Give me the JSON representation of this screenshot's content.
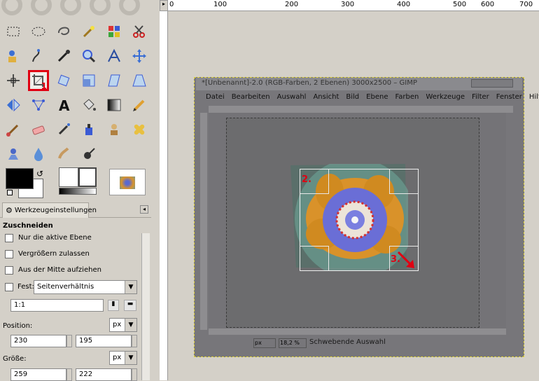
{
  "toolbox": {
    "tools": [
      "rect-select",
      "ellipse-select",
      "free-select",
      "fuzzy-select",
      "select-by-color",
      "scissors",
      "foreground-select",
      "paths",
      "color-picker",
      "zoom",
      "measure",
      "move",
      "align",
      "crop",
      "rotate",
      "scale",
      "shear",
      "perspective",
      "flip",
      "cage",
      "text",
      "bucket-fill",
      "blend",
      "pencil",
      "paintbrush",
      "eraser",
      "airbrush",
      "ink",
      "clone",
      "heal",
      "perspective-clone",
      "blur",
      "smudge",
      "dodge-burn"
    ],
    "selected_marker": "1"
  },
  "tab": {
    "label": "Werkzeugeinstellungen"
  },
  "options": {
    "heading": "Zuschneiden",
    "only_active_layer": "Nur die aktive Ebene",
    "allow_growing": "Vergrößern zulassen",
    "expand_center": "Aus der Mitte aufziehen",
    "fixed_label": "Fest:",
    "fixed_value": "Seitenverhältnis",
    "ratio_value": "1:1",
    "position_label": "Position:",
    "position_unit": "px",
    "pos_x": "230",
    "pos_y": "195",
    "size_label": "Größe:",
    "size_unit": "px",
    "size_w": "259",
    "size_h": "222"
  },
  "ruler": {
    "ticks": [
      "0",
      "100",
      "200",
      "300",
      "400",
      "500",
      "600",
      "700"
    ]
  },
  "inner": {
    "title": "*[Unbenannt]-2.0 (RGB-Farben, 2 Ebenen) 3000x2500 – GIMP",
    "menu": [
      "Datei",
      "Bearbeiten",
      "Auswahl",
      "Ansicht",
      "Bild",
      "Ebene",
      "Farben",
      "Werkzeuge",
      "Filter",
      "Fenster",
      "Hilfe"
    ],
    "marker2": "2.",
    "marker3": "3.",
    "unit": "px",
    "zoom": "18,2 %",
    "status": "Schwebende Auswahl"
  }
}
